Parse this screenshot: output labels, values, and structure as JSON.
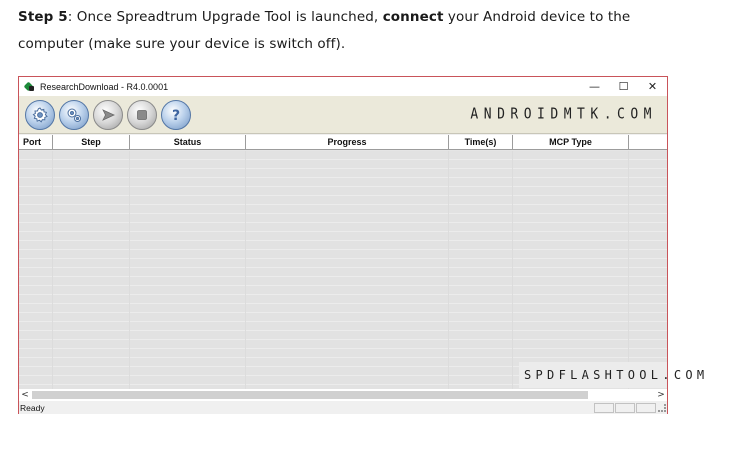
{
  "article": {
    "step_label": "Step 5",
    "text_part1": ": Once Spreadtrum Upgrade Tool is launched, ",
    "bold_word": "connect",
    "text_part2": " your Android device to the",
    "line2": "computer (make sure your device is switch off)."
  },
  "window": {
    "title": "ResearchDownload - R4.0.0001",
    "controls": {
      "minimize": "—",
      "maximize": "☐",
      "close": "✕"
    }
  },
  "toolbar": {
    "buttons": [
      {
        "name": "load-packet-button",
        "icon": "gear-icon"
      },
      {
        "name": "settings-button",
        "icon": "gears-icon"
      },
      {
        "name": "start-download-button",
        "icon": "play-icon"
      },
      {
        "name": "stop-download-button",
        "icon": "stop-icon"
      },
      {
        "name": "help-button",
        "icon": "help-icon"
      }
    ],
    "brand": "ANDROIDMTK.COM"
  },
  "grid": {
    "columns": [
      "Port",
      "Step",
      "Status",
      "Progress",
      "Time(s)",
      "MCP Type"
    ]
  },
  "watermark": "SPDFLASHTOOL.COM",
  "statusbar": {
    "text": "Ready"
  },
  "scroll": {
    "left_arrow": "<",
    "right_arrow": ">"
  },
  "colors": {
    "window_border": "#c9545a",
    "toolbar_bg": "#ebe9da",
    "button_blue": "#6f93c2"
  }
}
